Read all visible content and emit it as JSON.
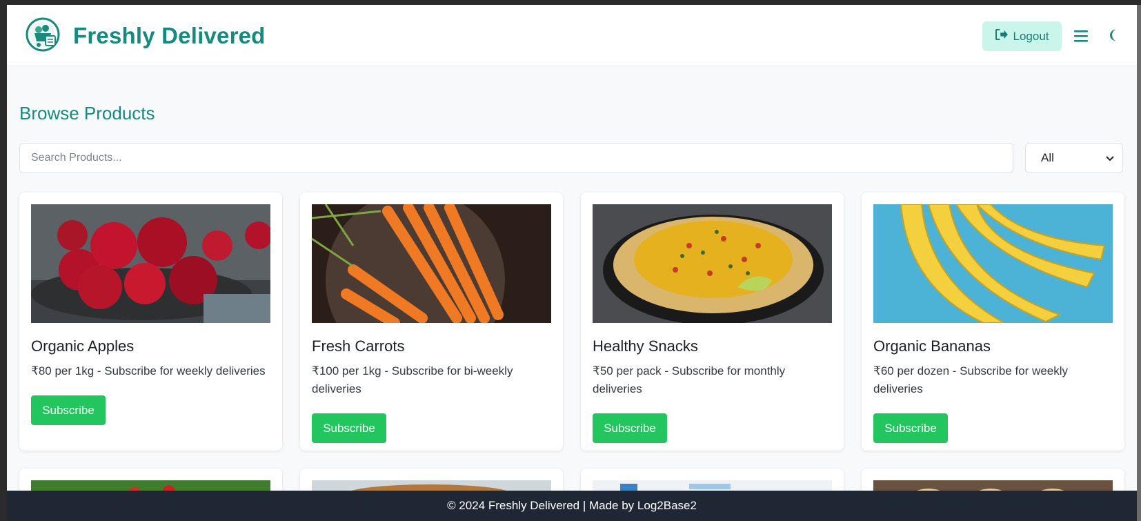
{
  "brand": {
    "name": "Freshly Delivered"
  },
  "navbar": {
    "logout_label": "Logout"
  },
  "page": {
    "title": "Browse Products"
  },
  "search": {
    "placeholder": "Search Products..."
  },
  "filter": {
    "selected": "All"
  },
  "products": [
    {
      "name": "Organic Apples",
      "description": "₹80 per 1kg - Subscribe for weekly deliveries",
      "button": "Subscribe"
    },
    {
      "name": "Fresh Carrots",
      "description": "₹100 per 1kg - Subscribe for bi-weekly deliveries",
      "button": "Subscribe"
    },
    {
      "name": "Healthy Snacks",
      "description": "₹50 per pack - Subscribe for monthly deliveries",
      "button": "Subscribe"
    },
    {
      "name": "Organic Bananas",
      "description": "₹60 per dozen - Subscribe for weekly deliveries",
      "button": "Subscribe"
    }
  ],
  "footer": {
    "text": "© 2024 Freshly Delivered | Made by Log2Base2"
  },
  "colors": {
    "brand": "#168a7e",
    "accent_button": "#22c55e",
    "footer_bg": "#1f2734",
    "logout_bg": "#c9f5ea"
  },
  "icons": {
    "logo": "delivery-basket-logo",
    "logout": "sign-out-icon",
    "menu": "hamburger-menu-icon",
    "theme": "moon-icon",
    "select": "chevron-down-icon"
  }
}
